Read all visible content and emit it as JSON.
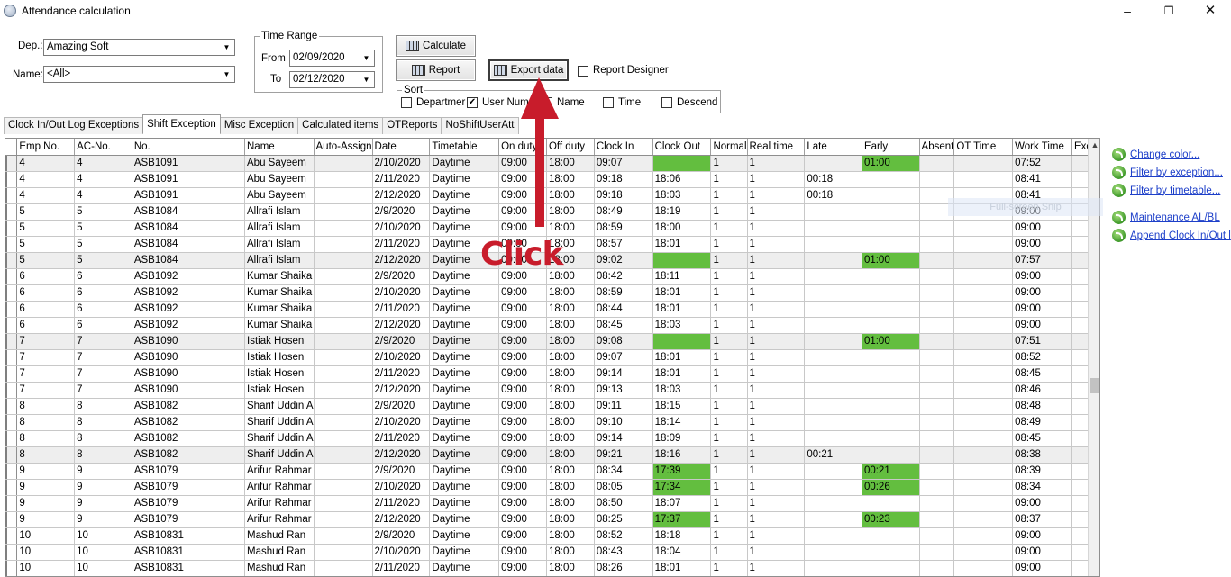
{
  "window": {
    "title": "Attendance calculation",
    "min": "–",
    "max": "❐",
    "close": "✕"
  },
  "form": {
    "dep_label": "Dep.:",
    "dep_value": "Amazing Soft",
    "name_label": "Name:",
    "name_value": "<All>",
    "time_range": {
      "title": "Time Range",
      "from_label": "From",
      "from_value": "02/09/2020",
      "to_label": "To",
      "to_value": "02/12/2020"
    },
    "buttons": {
      "calculate": "Calculate",
      "report": "Report",
      "export": "Export data"
    },
    "report_designer": "Report Designer",
    "sort": {
      "title": "Sort",
      "options": [
        {
          "label": "Departmer",
          "checked": false
        },
        {
          "label": "User Num",
          "checked": true
        },
        {
          "label": "Name",
          "checked": false
        },
        {
          "label": "Time",
          "checked": false
        },
        {
          "label": "Descend",
          "checked": false
        }
      ]
    }
  },
  "tabs": [
    "Clock In/Out Log Exceptions",
    "Shift Exception",
    "Misc Exception",
    "Calculated items",
    "OTReports",
    "NoShiftUserAtt"
  ],
  "active_tab": 1,
  "grid": {
    "columns": [
      "Emp No.",
      "AC-No.",
      "No.",
      "Name",
      "Auto-Assign",
      "Date",
      "Timetable",
      "On duty",
      "Off duty",
      "Clock In",
      "Clock Out",
      "Normal",
      "Real time",
      "Late",
      "Early",
      "Absent",
      "OT Time",
      "Work Time",
      "Exc"
    ],
    "rows": [
      [
        "4",
        "4",
        "ASB1091",
        "Abu Sayeem",
        "",
        "2/10/2020",
        "Daytime",
        "09:00",
        "18:00",
        "09:07",
        "",
        "1",
        "1",
        "",
        "01:00",
        "",
        "",
        "07:52",
        ""
      ],
      [
        "4",
        "4",
        "ASB1091",
        "Abu Sayeem",
        "",
        "2/11/2020",
        "Daytime",
        "09:00",
        "18:00",
        "09:18",
        "18:06",
        "1",
        "1",
        "00:18",
        "",
        "",
        "",
        "08:41",
        ""
      ],
      [
        "4",
        "4",
        "ASB1091",
        "Abu Sayeem",
        "",
        "2/12/2020",
        "Daytime",
        "09:00",
        "18:00",
        "09:18",
        "18:03",
        "1",
        "1",
        "00:18",
        "",
        "",
        "",
        "08:41",
        ""
      ],
      [
        "5",
        "5",
        "ASB1084",
        "Allrafi Islam",
        "",
        "2/9/2020",
        "Daytime",
        "09:00",
        "18:00",
        "08:49",
        "18:19",
        "1",
        "1",
        "",
        "",
        "",
        "",
        "09:00",
        ""
      ],
      [
        "5",
        "5",
        "ASB1084",
        "Allrafi Islam",
        "",
        "2/10/2020",
        "Daytime",
        "09:00",
        "18:00",
        "08:59",
        "18:00",
        "1",
        "1",
        "",
        "",
        "",
        "",
        "09:00",
        ""
      ],
      [
        "5",
        "5",
        "ASB1084",
        "Allrafi Islam",
        "",
        "2/11/2020",
        "Daytime",
        "09:00",
        "18:00",
        "08:57",
        "18:01",
        "1",
        "1",
        "",
        "",
        "",
        "",
        "09:00",
        ""
      ],
      [
        "5",
        "5",
        "ASB1084",
        "Allrafi Islam",
        "",
        "2/12/2020",
        "Daytime",
        "09:00",
        "18:00",
        "09:02",
        "",
        "1",
        "1",
        "",
        "01:00",
        "",
        "",
        "07:57",
        ""
      ],
      [
        "6",
        "6",
        "ASB1092",
        "Kumar Shaika",
        "",
        "2/9/2020",
        "Daytime",
        "09:00",
        "18:00",
        "08:42",
        "18:11",
        "1",
        "1",
        "",
        "",
        "",
        "",
        "09:00",
        ""
      ],
      [
        "6",
        "6",
        "ASB1092",
        "Kumar Shaika",
        "",
        "2/10/2020",
        "Daytime",
        "09:00",
        "18:00",
        "08:59",
        "18:01",
        "1",
        "1",
        "",
        "",
        "",
        "",
        "09:00",
        ""
      ],
      [
        "6",
        "6",
        "ASB1092",
        "Kumar Shaika",
        "",
        "2/11/2020",
        "Daytime",
        "09:00",
        "18:00",
        "08:44",
        "18:01",
        "1",
        "1",
        "",
        "",
        "",
        "",
        "09:00",
        ""
      ],
      [
        "6",
        "6",
        "ASB1092",
        "Kumar Shaika",
        "",
        "2/12/2020",
        "Daytime",
        "09:00",
        "18:00",
        "08:45",
        "18:03",
        "1",
        "1",
        "",
        "",
        "",
        "",
        "09:00",
        ""
      ],
      [
        "7",
        "7",
        "ASB1090",
        "Istiak Hosen",
        "",
        "2/9/2020",
        "Daytime",
        "09:00",
        "18:00",
        "09:08",
        "",
        "1",
        "1",
        "",
        "01:00",
        "",
        "",
        "07:51",
        ""
      ],
      [
        "7",
        "7",
        "ASB1090",
        "Istiak Hosen",
        "",
        "2/10/2020",
        "Daytime",
        "09:00",
        "18:00",
        "09:07",
        "18:01",
        "1",
        "1",
        "",
        "",
        "",
        "",
        "08:52",
        ""
      ],
      [
        "7",
        "7",
        "ASB1090",
        "Istiak Hosen",
        "",
        "2/11/2020",
        "Daytime",
        "09:00",
        "18:00",
        "09:14",
        "18:01",
        "1",
        "1",
        "",
        "",
        "",
        "",
        "08:45",
        ""
      ],
      [
        "7",
        "7",
        "ASB1090",
        "Istiak Hosen",
        "",
        "2/12/2020",
        "Daytime",
        "09:00",
        "18:00",
        "09:13",
        "18:03",
        "1",
        "1",
        "",
        "",
        "",
        "",
        "08:46",
        ""
      ],
      [
        "8",
        "8",
        "ASB1082",
        "Sharif Uddin A",
        "",
        "2/9/2020",
        "Daytime",
        "09:00",
        "18:00",
        "09:11",
        "18:15",
        "1",
        "1",
        "",
        "",
        "",
        "",
        "08:48",
        ""
      ],
      [
        "8",
        "8",
        "ASB1082",
        "Sharif Uddin A",
        "",
        "2/10/2020",
        "Daytime",
        "09:00",
        "18:00",
        "09:10",
        "18:14",
        "1",
        "1",
        "",
        "",
        "",
        "",
        "08:49",
        ""
      ],
      [
        "8",
        "8",
        "ASB1082",
        "Sharif Uddin A",
        "",
        "2/11/2020",
        "Daytime",
        "09:00",
        "18:00",
        "09:14",
        "18:09",
        "1",
        "1",
        "",
        "",
        "",
        "",
        "08:45",
        ""
      ],
      [
        "8",
        "8",
        "ASB1082",
        "Sharif Uddin A",
        "",
        "2/12/2020",
        "Daytime",
        "09:00",
        "18:00",
        "09:21",
        "18:16",
        "1",
        "1",
        "00:21",
        "",
        "",
        "",
        "08:38",
        ""
      ],
      [
        "9",
        "9",
        "ASB1079",
        "Arifur Rahmar",
        "",
        "2/9/2020",
        "Daytime",
        "09:00",
        "18:00",
        "08:34",
        "17:39",
        "1",
        "1",
        "",
        "00:21",
        "",
        "",
        "08:39",
        ""
      ],
      [
        "9",
        "9",
        "ASB1079",
        "Arifur Rahmar",
        "",
        "2/10/2020",
        "Daytime",
        "09:00",
        "18:00",
        "08:05",
        "17:34",
        "1",
        "1",
        "",
        "00:26",
        "",
        "",
        "08:34",
        ""
      ],
      [
        "9",
        "9",
        "ASB1079",
        "Arifur Rahmar",
        "",
        "2/11/2020",
        "Daytime",
        "09:00",
        "18:00",
        "08:50",
        "18:07",
        "1",
        "1",
        "",
        "",
        "",
        "",
        "09:00",
        ""
      ],
      [
        "9",
        "9",
        "ASB1079",
        "Arifur Rahmar",
        "",
        "2/12/2020",
        "Daytime",
        "09:00",
        "18:00",
        "08:25",
        "17:37",
        "1",
        "1",
        "",
        "00:23",
        "",
        "",
        "08:37",
        ""
      ],
      [
        "10",
        "10",
        "ASB10831",
        "Mashud Ran",
        "",
        "2/9/2020",
        "Daytime",
        "09:00",
        "18:00",
        "08:52",
        "18:18",
        "1",
        "1",
        "",
        "",
        "",
        "",
        "09:00",
        ""
      ],
      [
        "10",
        "10",
        "ASB10831",
        "Mashud Ran",
        "",
        "2/10/2020",
        "Daytime",
        "09:00",
        "18:00",
        "08:43",
        "18:04",
        "1",
        "1",
        "",
        "",
        "",
        "",
        "09:00",
        ""
      ],
      [
        "10",
        "10",
        "ASB10831",
        "Mashud Ran",
        "",
        "2/11/2020",
        "Daytime",
        "09:00",
        "18:00",
        "08:26",
        "18:01",
        "1",
        "1",
        "",
        "",
        "",
        "",
        "09:00",
        ""
      ]
    ],
    "highlight_color": "#63be3f",
    "highlighted_rows": [
      0,
      6,
      11,
      18
    ],
    "green_cells": [
      [
        0,
        10
      ],
      [
        0,
        14
      ],
      [
        6,
        10
      ],
      [
        6,
        14
      ],
      [
        11,
        10
      ],
      [
        11,
        14
      ],
      [
        19,
        10
      ],
      [
        19,
        14
      ],
      [
        20,
        10
      ],
      [
        20,
        14
      ],
      [
        22,
        10
      ],
      [
        22,
        14
      ]
    ]
  },
  "side_links": [
    "Change color...",
    "Filter by exception...",
    "Filter by timetable...",
    "Maintenance AL/BL",
    "Append Clock In/Out l"
  ],
  "snip_ghost": "Full-screen Snip",
  "annotation": {
    "text": "Click",
    "color": "#c81c2b"
  }
}
